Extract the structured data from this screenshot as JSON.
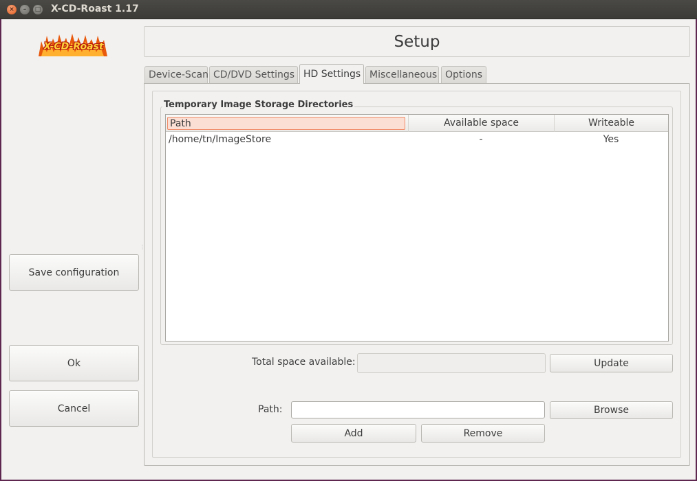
{
  "window": {
    "title": "X-CD-Roast 1.17",
    "close_glyph": "×",
    "min_glyph": "–",
    "max_glyph": "□"
  },
  "logo": {
    "text": "X-CD-Roast",
    "flame_color": "#e8590c",
    "text_color": "#ffd23a"
  },
  "sidebar": {
    "save_label": "Save configuration",
    "ok_label": "Ok",
    "cancel_label": "Cancel"
  },
  "header": {
    "title": "Setup"
  },
  "tabs": [
    {
      "label": "Device-Scan",
      "active": false
    },
    {
      "label": "CD/DVD Settings",
      "active": false
    },
    {
      "label": "HD Settings",
      "active": true
    },
    {
      "label": "Miscellaneous",
      "active": false
    },
    {
      "label": "Options",
      "active": false
    }
  ],
  "storage": {
    "group_label": "Temporary Image Storage Directories",
    "columns": [
      "Path",
      "Available space",
      "Writeable"
    ],
    "rows": [
      {
        "path": "/home/tn/ImageStore",
        "space": "-",
        "writeable": "Yes"
      }
    ]
  },
  "total": {
    "label": "Total space available:",
    "value": "",
    "update_label": "Update"
  },
  "path_row": {
    "label": "Path:",
    "value": "",
    "browse_label": "Browse",
    "add_label": "Add",
    "remove_label": "Remove"
  },
  "colors": {
    "accent": "#f08d6a",
    "titlebar": "#3c3b37",
    "window_bg": "#f2f1f0"
  }
}
